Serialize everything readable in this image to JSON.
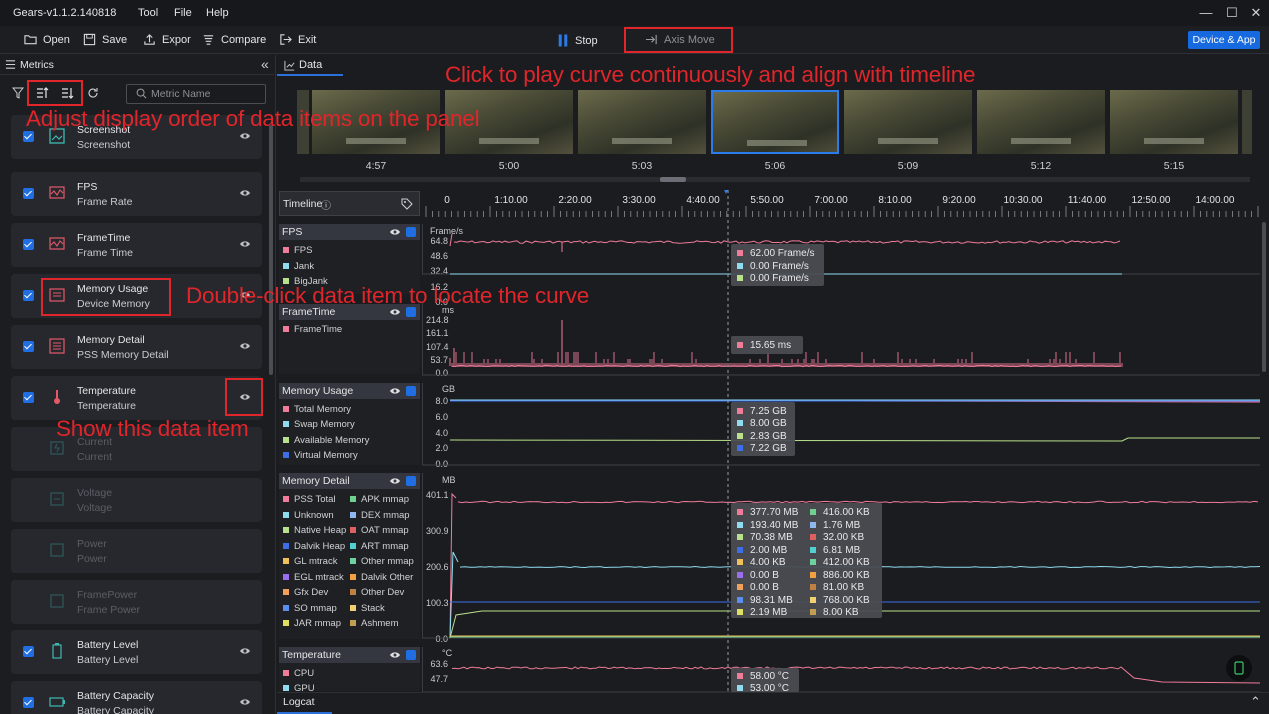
{
  "app": {
    "title": "Gears-v1.1.2.140818"
  },
  "menu": [
    "Tool",
    "File",
    "Help"
  ],
  "toolbar": {
    "open": "Open",
    "save": "Save",
    "export": "Expor",
    "compare": "Compare",
    "exit": "Exit",
    "stop": "Stop",
    "axis_move": "Axis Move",
    "device_app": "Device & App"
  },
  "sidebar": {
    "title": "Metrics",
    "search_placeholder": "Metric Name",
    "items": [
      {
        "l1": "Screenshot",
        "l2": "Screenshot",
        "enabled": true
      },
      {
        "l1": "FPS",
        "l2": "Frame Rate",
        "enabled": true
      },
      {
        "l1": "FrameTime",
        "l2": "Frame Time",
        "enabled": true
      },
      {
        "l1": "Memory Usage",
        "l2": "Device Memory",
        "enabled": true
      },
      {
        "l1": "Memory Detail",
        "l2": "PSS Memory Detail",
        "enabled": true
      },
      {
        "l1": "Temperature",
        "l2": "Temperature",
        "enabled": true
      },
      {
        "l1": "Current",
        "l2": "Current",
        "enabled": false
      },
      {
        "l1": "Voltage",
        "l2": "Voltage",
        "enabled": false
      },
      {
        "l1": "Power",
        "l2": "Power",
        "enabled": false
      },
      {
        "l1": "FramePower",
        "l2": "Frame Power",
        "enabled": false
      },
      {
        "l1": "Battery Level",
        "l2": "Battery Level",
        "enabled": true
      },
      {
        "l1": "Battery Capacity",
        "l2": "Battery Capacity",
        "enabled": true
      }
    ]
  },
  "data_tab": "Data",
  "screenshots": [
    "4:57",
    "5:00",
    "5:03",
    "5:06",
    "5:09",
    "5:12",
    "5:15"
  ],
  "timeline": {
    "label": "Timeline",
    "ticks": [
      "0",
      "1:10.00",
      "2:20.00",
      "3:30.00",
      "4:40.00",
      "5:50.00",
      "7:00.00",
      "8:10.00",
      "9:20.00",
      "10:30.00",
      "11:40.00",
      "12:50.00",
      "14:00.00"
    ]
  },
  "panels": {
    "fps": {
      "title": "FPS",
      "unit": "Frame/s",
      "legend": [
        "FPS",
        "Jank",
        "BigJank"
      ],
      "yticks": [
        "64.8",
        "48.6",
        "32.4",
        "16.2",
        "0.0"
      ],
      "tip": [
        "62.00  Frame/s",
        "0.00  Frame/s",
        "0.00  Frame/s"
      ]
    },
    "frametime": {
      "title": "FrameTime",
      "unit": "ms",
      "legend": [
        "FrameTime"
      ],
      "yticks": [
        "214.8",
        "161.1",
        "107.4",
        "53.7",
        "0.0"
      ],
      "tip": [
        "15.65  ms"
      ]
    },
    "memory_usage": {
      "title": "Memory Usage",
      "unit": "GB",
      "legend": [
        "Total Memory",
        "Swap Memory",
        "Available Memory",
        "Virtual Memory"
      ],
      "yticks": [
        "8.0",
        "6.0",
        "4.0",
        "2.0",
        "0.0"
      ],
      "tip": [
        "7.25  GB",
        "8.00  GB",
        "2.83  GB",
        "7.22  GB"
      ]
    },
    "memory_detail": {
      "title": "Memory Detail",
      "unit": "MB",
      "legend_left": [
        "PSS Total",
        "Unknown",
        "Native Heap",
        "Dalvik Heap",
        "GL mtrack",
        "EGL mtrack",
        "Gfx Dev",
        "SO mmap",
        "JAR mmap"
      ],
      "legend_right": [
        "APK mmap",
        "DEX mmap",
        "OAT mmap",
        "ART mmap",
        "Other mmap",
        "Dalvik Other",
        "Other Dev",
        "Stack",
        "Ashmem"
      ],
      "yticks": [
        "401.1",
        "300.9",
        "200.6",
        "100.3",
        "0.0"
      ],
      "tip_left": [
        "377.70  MB",
        "193.40  MB",
        "70.38  MB",
        "2.00  MB",
        "4.00  KB",
        "0.00  B",
        "0.00  B",
        "98.31  MB",
        "2.19  MB"
      ],
      "tip_right": [
        "416.00  KB",
        "1.76  MB",
        "32.00  KB",
        "6.81  MB",
        "412.00  KB",
        "886.00  KB",
        "81.00  KB",
        "768.00  KB",
        "8.00  KB"
      ]
    },
    "temperature": {
      "title": "Temperature",
      "unit": "°C",
      "legend": [
        "CPU",
        "GPU"
      ],
      "yticks": [
        "63.6",
        "47.7"
      ],
      "tip": [
        "58.00  °C",
        "53.00  °C"
      ]
    }
  },
  "bottom": {
    "logcat": "Logcat"
  },
  "annotations": {
    "play": "Click to play curve continuously and align with timeline",
    "order": "Adjust display order of data items on the panel",
    "locate": "Double-click data item to locate the curve",
    "show": "Show this data item"
  },
  "colors": {
    "accent": "#1f6fe3",
    "annotation": "#e0252b",
    "pink": "#f07c9a",
    "cyan": "#8fdcf0",
    "green": "#b9e08a",
    "blue": "#3d6ee8"
  }
}
